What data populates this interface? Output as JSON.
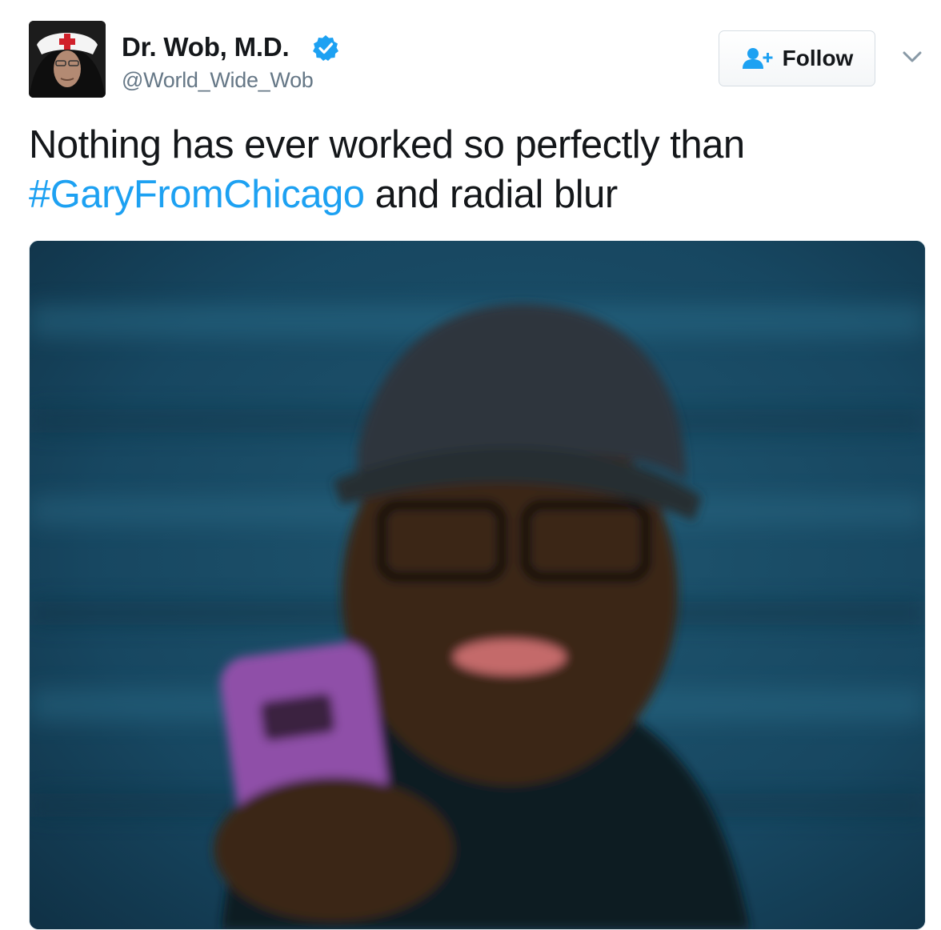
{
  "tweet": {
    "author": {
      "display_name": "Dr. Wob, M.D.",
      "handle": "@World_Wide_Wob",
      "verified": true,
      "avatar_icon": "nurse-hat-avatar"
    },
    "follow_button": {
      "label": "Follow",
      "icon": "add-user-icon"
    },
    "menu_icon": "chevron-down-icon",
    "text_before_hashtag": "Nothing has ever worked so perfectly than ",
    "hashtag": "#GaryFromChicago",
    "text_after_hashtag": " and radial blur",
    "media": {
      "type": "photo",
      "description_icon": "photo"
    }
  },
  "colors": {
    "hashtag": "#1da1f2",
    "verified_badge": "#1da1f2",
    "follow_icon": "#1da1f2",
    "handle": "#657786",
    "text": "#14171a",
    "media_background": "#164058"
  }
}
